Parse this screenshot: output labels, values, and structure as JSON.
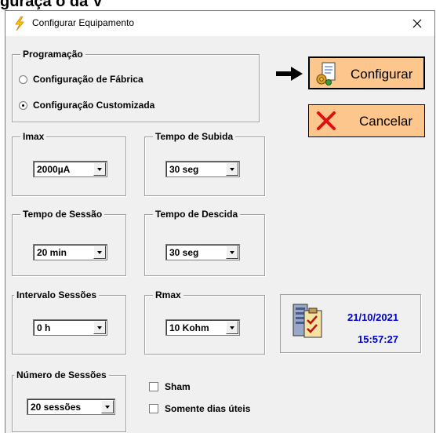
{
  "top_strip_text": "guraça o da V",
  "window": {
    "title": "Configurar Equipamento",
    "close_glyph": "×"
  },
  "programacao": {
    "legend": "Programação",
    "options": [
      {
        "label": "Configuração de Fábrica",
        "selected": false
      },
      {
        "label": "Configuração Customizada",
        "selected": true
      }
    ]
  },
  "buttons": {
    "configurar": "Configurar",
    "cancelar": "Cancelar"
  },
  "imax": {
    "legend": "Imax",
    "value": "2000µA"
  },
  "tempo_subida": {
    "legend": "Tempo de Subida",
    "value": "30 seg"
  },
  "tempo_sessao": {
    "legend": "Tempo de Sessão",
    "value": "20 min"
  },
  "tempo_descida": {
    "legend": "Tempo de Descida",
    "value": "30 seg"
  },
  "intervalo_sessoes": {
    "legend": "Intervalo Sessões",
    "value": "0 h"
  },
  "rmax": {
    "legend": "Rmax",
    "value": "10 Kohm"
  },
  "numero_sessoes": {
    "legend": "Número de Sessões",
    "value": "20 sessões"
  },
  "checkboxes": {
    "sham": "Sham",
    "dias_uteis": "Somente dias úteis"
  },
  "datetime": {
    "date": "21/10/2021",
    "time": "15:57:27"
  },
  "colors": {
    "button_bg": "#fcc68c",
    "datetime_text": "#0000cc",
    "window_bg": "#f0f0f0"
  },
  "icons": [
    "lightning-icon",
    "close-icon",
    "arrow-right-icon",
    "config-gear-document-icon",
    "cancel-x-icon",
    "server-checklist-icon"
  ]
}
